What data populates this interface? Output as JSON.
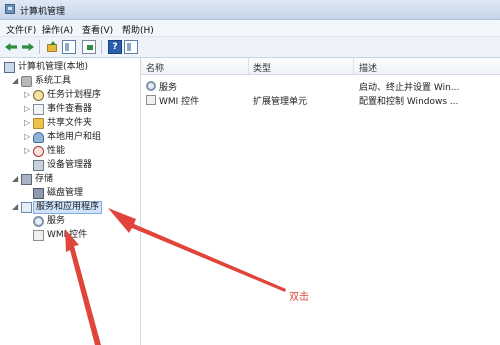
{
  "window": {
    "title": "计算机管理"
  },
  "menu": [
    "文件(F)",
    "操作(A)",
    "查看(V)",
    "帮助(H)"
  ],
  "toolbar": {
    "help_label": "?"
  },
  "tree": {
    "root": "计算机管理(本地)",
    "system_tools": "系统工具",
    "task_scheduler": "任务计划程序",
    "event_viewer": "事件查看器",
    "shared_folders": "共享文件夹",
    "local_users": "本地用户和组",
    "performance": "性能",
    "device_manager": "设备管理器",
    "storage": "存储",
    "disk_management": "磁盘管理",
    "services_apps": "服务和应用程序",
    "services": "服务",
    "wmi": "WMI 控件"
  },
  "list": {
    "columns": [
      "名称",
      "类型",
      "描述"
    ],
    "rows": [
      {
        "name": "服务",
        "type": "",
        "desc": "启动、终止并设置 Win..."
      },
      {
        "name": "WMI 控件",
        "type": "扩展管理单元",
        "desc": "配置和控制 Windows ..."
      }
    ]
  },
  "annotation": {
    "text": "双击",
    "color": "#d84a3a"
  }
}
